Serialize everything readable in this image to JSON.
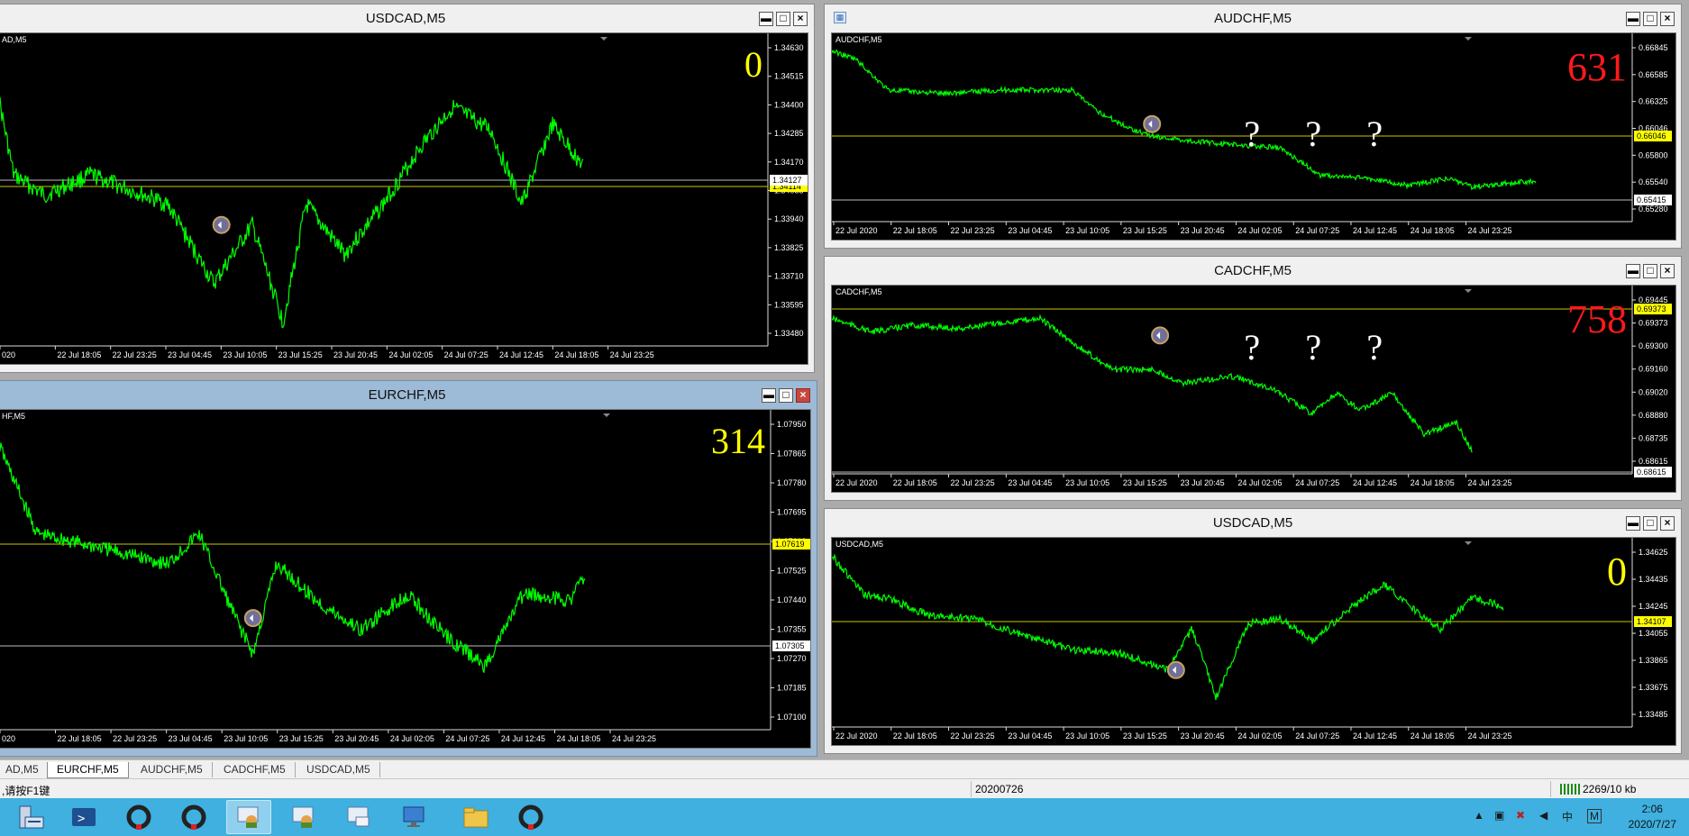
{
  "charts": [
    {
      "id": "c1",
      "title": "USDCAD,M5",
      "chart_label": "AD,M5",
      "counter": "0",
      "counter_color": "#ffff00",
      "questions": [],
      "prices": [
        "1.34630",
        "1.34515",
        "1.34400",
        "1.34285",
        "1.34170",
        "1.34055",
        "1.33940",
        "1.33825",
        "1.33710",
        "1.33595",
        "1.33480"
      ],
      "tag1": "1.34114",
      "tag2": "1.34127",
      "times": [
        "020",
        "22 Jul 18:05",
        "22 Jul 23:25",
        "23 Jul 04:45",
        "23 Jul 10:05",
        "23 Jul 15:25",
        "23 Jul 20:45",
        "24 Jul 02:05",
        "24 Jul 07:25",
        "24 Jul 12:45",
        "24 Jul 18:05",
        "24 Jul 23:25"
      ],
      "close_label": "×"
    },
    {
      "id": "c2",
      "title": "EURCHF,M5",
      "chart_label": "HF,M5",
      "counter": "314",
      "counter_color": "#ffff00",
      "questions": [],
      "prices": [
        "1.07950",
        "1.07865",
        "1.07780",
        "1.07695",
        "1.07610",
        "1.07525",
        "1.07440",
        "1.07355",
        "1.07270",
        "1.07185",
        "1.07100"
      ],
      "tag1": "1.07619",
      "tag2": "1.07305",
      "times": [
        "020",
        "22 Jul 18:05",
        "22 Jul 23:25",
        "23 Jul 04:45",
        "23 Jul 10:05",
        "23 Jul 15:25",
        "23 Jul 20:45",
        "24 Jul 02:05",
        "24 Jul 07:25",
        "24 Jul 12:45",
        "24 Jul 18:05",
        "24 Jul 23:25"
      ],
      "close_label": "×"
    },
    {
      "id": "c3",
      "title": "AUDCHF,M5",
      "chart_label": "AUDCHF,M5",
      "counter": "631",
      "counter_color": "#ff1a1a",
      "questions": [
        "?",
        "?",
        "?"
      ],
      "prices": [
        "0.66845",
        "0.66585",
        "0.66325",
        "0.66046",
        "0.65800",
        "0.65540",
        "0.65280"
      ],
      "tag1": "0.66046",
      "tag2": "0.65415",
      "times": [
        "22 Jul 2020",
        "22 Jul 18:05",
        "22 Jul 23:25",
        "23 Jul 04:45",
        "23 Jul 10:05",
        "23 Jul 15:25",
        "23 Jul 20:45",
        "24 Jul 02:05",
        "24 Jul 07:25",
        "24 Jul 12:45",
        "24 Jul 18:05",
        "24 Jul 23:25"
      ],
      "close_label": "×"
    },
    {
      "id": "c4",
      "title": "CADCHF,M5",
      "chart_label": "CADCHF,M5",
      "counter": "758",
      "counter_color": "#ff1a1a",
      "questions": [
        "?",
        "?",
        "?"
      ],
      "prices": [
        "0.69445",
        "0.69373",
        "0.69300",
        "0.69160",
        "0.69020",
        "0.68880",
        "0.68735",
        "0.68615"
      ],
      "tag1": "0.69373",
      "tag2": "0.68615",
      "times": [
        "22 Jul 2020",
        "22 Jul 18:05",
        "22 Jul 23:25",
        "23 Jul 04:45",
        "23 Jul 10:05",
        "23 Jul 15:25",
        "23 Jul 20:45",
        "24 Jul 02:05",
        "24 Jul 07:25",
        "24 Jul 12:45",
        "24 Jul 18:05",
        "24 Jul 23:25"
      ],
      "close_label": "×"
    },
    {
      "id": "c5",
      "title": "USDCAD,M5",
      "chart_label": "USDCAD,M5",
      "counter": "0",
      "counter_color": "#ffff00",
      "questions": [],
      "prices": [
        "1.34625",
        "1.34435",
        "1.34245",
        "1.34055",
        "1.33865",
        "1.33675",
        "1.33485"
      ],
      "tag1": "1.34107",
      "tag2": "1.34107",
      "times": [
        "22 Jul 2020",
        "22 Jul 18:05",
        "22 Jul 23:25",
        "23 Jul 04:45",
        "23 Jul 10:05",
        "23 Jul 15:25",
        "23 Jul 20:45",
        "24 Jul 02:05",
        "24 Jul 07:25",
        "24 Jul 12:45",
        "24 Jul 18:05",
        "24 Jul 23:25"
      ],
      "close_label": "×"
    }
  ],
  "tabs": [
    "AD,M5",
    "EURCHF,M5",
    "AUDCHF,M5",
    "CADCHF,M5",
    "USDCAD,M5"
  ],
  "selected_tab": "EURCHF,M5",
  "status": {
    "help": ",请按F1键",
    "date": "20200726",
    "traffic": "2269/10 kb"
  },
  "clock": {
    "time": "2:06",
    "date": "2020/7/27"
  },
  "colors": {
    "line": "#00ff00",
    "price_line": "#c8c800",
    "chart_bg": "#000000"
  }
}
